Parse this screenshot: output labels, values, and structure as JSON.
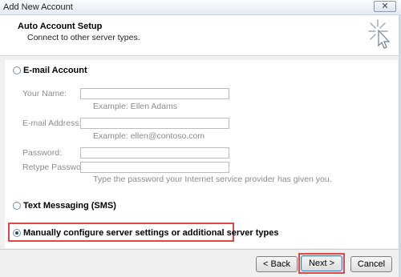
{
  "window": {
    "title": "Add New Account",
    "close_label": "✕"
  },
  "header": {
    "title": "Auto Account Setup",
    "subtitle": "Connect to other server types."
  },
  "options": {
    "email_account": {
      "label": "E-mail Account",
      "selected": false
    },
    "text_messaging": {
      "label": "Text Messaging (SMS)",
      "selected": false
    },
    "manual": {
      "label": "Manually configure server settings or additional server types",
      "selected": true
    }
  },
  "email_form": {
    "your_name_label": "Your Name:",
    "your_name_value": "",
    "your_name_hint": "Example: Ellen Adams",
    "email_label": "E-mail Address:",
    "email_value": "",
    "email_hint": "Example: ellen@contoso.com",
    "password_label": "Password:",
    "password_value": "",
    "retype_label": "Retype Password:",
    "retype_value": "",
    "password_hint": "Type the password your Internet service provider has given you."
  },
  "buttons": {
    "back": "< Back",
    "next": "Next >",
    "cancel": "Cancel"
  },
  "colors": {
    "highlight": "#e04848",
    "header_bg": "#ffffff",
    "dialog_bg": "#f0f0f0"
  }
}
